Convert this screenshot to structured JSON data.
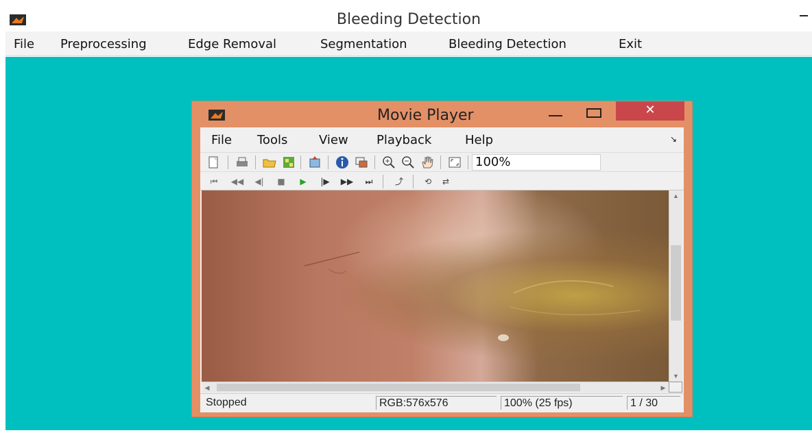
{
  "app": {
    "title": "Bleeding Detection",
    "menu": [
      "File",
      "Preprocessing",
      "Edge Removal",
      "Segmentation",
      "Bleeding Detection",
      "Exit"
    ]
  },
  "colors": {
    "workspace": "#00bfbf",
    "player_frame": "#e39066",
    "close_button": "#c9474a",
    "play_green": "#27a327"
  },
  "player": {
    "title": "Movie Player",
    "close_glyph": "✕",
    "menu": [
      "File",
      "Tools",
      "View",
      "Playback",
      "Help"
    ],
    "zoom": "100%",
    "toolbar_icons": [
      "new-figure-icon",
      "print-icon",
      "open-icon",
      "import-icon",
      "export-icon",
      "info-icon",
      "colormap-icon",
      "zoom-in-icon",
      "zoom-out-icon",
      "pan-icon",
      "fit-window-icon"
    ],
    "playback_icons": [
      "go-to-first-icon",
      "rewind-icon",
      "step-back-icon",
      "stop-icon",
      "play-icon",
      "step-forward-icon",
      "fast-forward-icon",
      "go-to-last-icon",
      "jump-to-icon",
      "autoreverse-icon",
      "loop-icon"
    ],
    "status": {
      "state": "Stopped",
      "format": "RGB:576x576",
      "rate": "100% (25 fps)",
      "frame": "1 / 30"
    }
  }
}
